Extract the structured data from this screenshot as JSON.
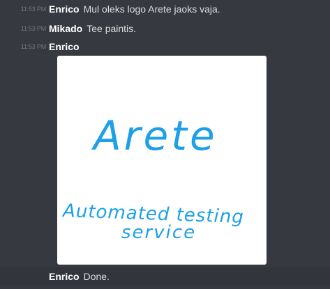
{
  "messages": [
    {
      "time": "11:53 PM",
      "author": "Enrico",
      "text": "Mul oleks logo Arete jaoks vaja."
    },
    {
      "time": "11:53 PM",
      "author": "Mikado",
      "text": "Tee paintis."
    },
    {
      "time": "11:53 PM",
      "author": "Enrico",
      "text": ""
    },
    {
      "time": "",
      "author": "Enrico",
      "text": "Done."
    }
  ],
  "attachment": {
    "title": "Arete",
    "line1": "Automated testing",
    "line2": "service",
    "ink_color": "#1ea0e6"
  }
}
